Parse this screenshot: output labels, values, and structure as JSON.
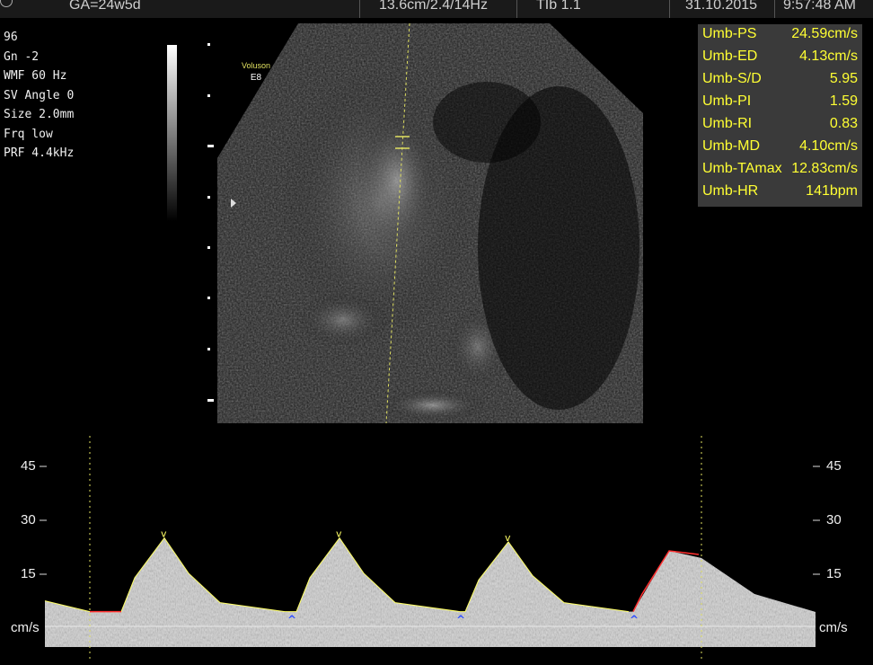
{
  "header": {
    "exam": "GA=24w5d",
    "depth_freq": "13.6cm/2.4/14Hz",
    "thermal_index": "TIb 1.1",
    "date": "31.10.2015",
    "time": "9:57:48 AM"
  },
  "params": [
    "96",
    "Gn  -2",
    "WMF 60 Hz",
    "SV Angle  0",
    "Size  2.0mm",
    "Frq low",
    "PRF  4.4kHz"
  ],
  "probe": {
    "brand": "Voluson",
    "model": "E8"
  },
  "measurements": [
    {
      "label": "Umb-PS",
      "value": "24.59cm/s"
    },
    {
      "label": "Umb-ED",
      "value": "4.13cm/s"
    },
    {
      "label": "Umb-S/D",
      "value": "5.95"
    },
    {
      "label": "Umb-PI",
      "value": "1.59"
    },
    {
      "label": "Umb-RI",
      "value": "0.83"
    },
    {
      "label": "Umb-MD",
      "value": "4.10cm/s"
    },
    {
      "label": "Umb-TAmax",
      "value": "12.83cm/s"
    },
    {
      "label": "Umb-HR",
      "value": "141bpm"
    }
  ],
  "spectrum": {
    "unit": "cm/s",
    "ticks": [
      "45",
      "30",
      "15"
    ],
    "ymax": 45,
    "trace_color": "#ffff66",
    "active_trace_color": "#ff3030",
    "marker_color": "#3050ff",
    "peaks_cm_s": [
      24.6,
      24.6,
      23.5
    ],
    "end_diastole_cm_s": 4.1
  },
  "colors": {
    "measure_text": "#ffff33",
    "measure_bg": "#3a3a3a",
    "cursor": "#e0e060"
  }
}
